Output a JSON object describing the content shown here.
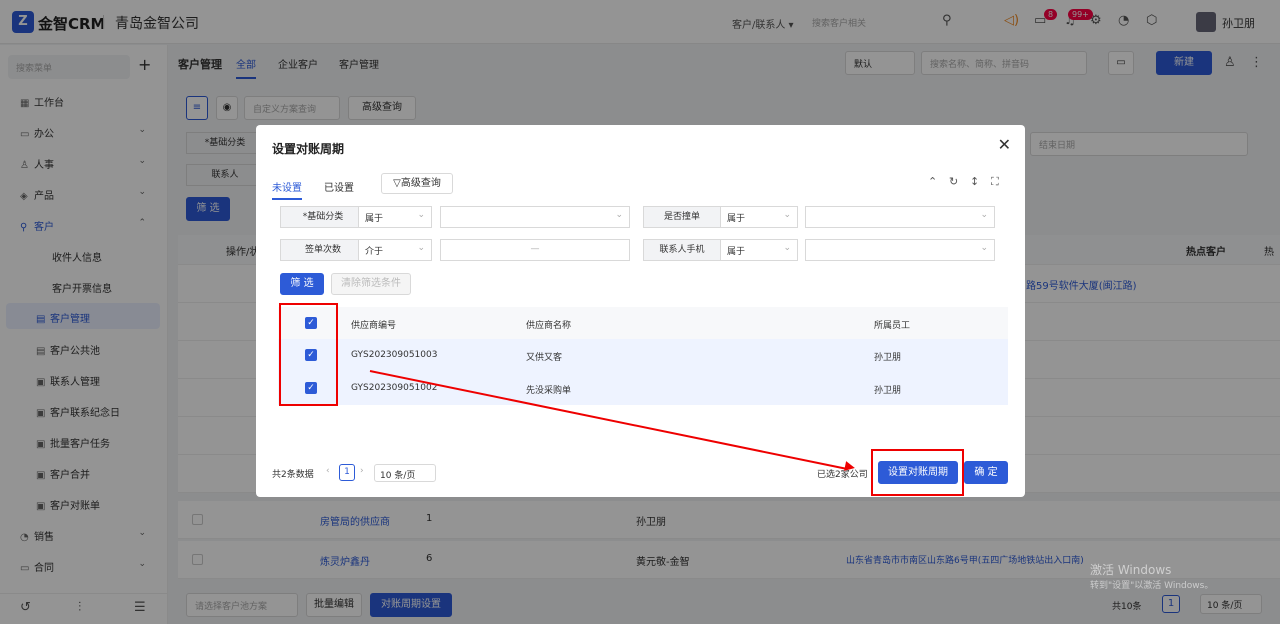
{
  "topbar": {
    "logo_glyph": "Z",
    "brand": "金智CRM",
    "company": "青岛金智公司",
    "search_scope": "客户/联系人 ▾",
    "search_placeholder": "搜索客户相关",
    "badge_msg": "8",
    "badge_notice": "99+",
    "username": "孙卫朋",
    "icons": [
      "search-icon",
      "volume-icon",
      "message-icon",
      "bell-icon",
      "gear-icon",
      "pie-icon",
      "cube-icon"
    ]
  },
  "sidebar": {
    "search_placeholder": "搜索菜单",
    "items": [
      {
        "label": "工作台",
        "icon": "▦"
      },
      {
        "label": "办公",
        "icon": "▭"
      },
      {
        "label": "人事",
        "icon": "♙"
      },
      {
        "label": "产品",
        "icon": "◈"
      },
      {
        "label": "客户",
        "icon": "⚲"
      },
      {
        "label": "收件人信息"
      },
      {
        "label": "客户开票信息"
      },
      {
        "label": "客户管理",
        "icon": "▤"
      },
      {
        "label": "客户公共池",
        "icon": "▤"
      },
      {
        "label": "联系人管理",
        "icon": "▣"
      },
      {
        "label": "客户联系纪念日",
        "icon": "▣"
      },
      {
        "label": "批量客户任务",
        "icon": "▣"
      },
      {
        "label": "客户合并",
        "icon": "▣"
      },
      {
        "label": "客户对账单",
        "icon": "▣"
      },
      {
        "label": "销售",
        "icon": "◔"
      },
      {
        "label": "合同",
        "icon": "▭"
      }
    ]
  },
  "main": {
    "title": "客户管理",
    "tabs": [
      "全部",
      "企业客户",
      "客户管理"
    ],
    "sort_select": "默认",
    "search_placeholder": "搜索名称、简称、拼音码",
    "new_button": "新建",
    "custom_query": "自定义方案查询",
    "advanced_query": "高级查询",
    "filter_label_base": "*基础分类",
    "filter_label_contact": "联系人",
    "filter_button": "筛 选",
    "end_date": "结束日期",
    "col_ops": "操作/状",
    "col_hot": "热点客户",
    "col_hot2": "热",
    "row_addr_partial": "路59号软件大厦(闽江路)",
    "rows": [
      {
        "name": "房管局的供应商",
        "count": "1",
        "owner": "孙卫朋",
        "address": ""
      },
      {
        "name": "炼灵炉鑫丹",
        "count": "6",
        "owner": "黄元敬-金智",
        "address": "山东省青岛市市南区山东路6号甲(五四广场地铁站出入口南)"
      }
    ],
    "bottom_scheme": "请选择客户池方案",
    "bottom_batch": "批量编辑",
    "bottom_period": "对账周期设置",
    "total": "共10条",
    "page": "1",
    "per_page": "10 条/页"
  },
  "dialog": {
    "title": "设置对账周期",
    "tabs": [
      "未设置",
      "已设置"
    ],
    "advanced_query": "高级查询",
    "filters": [
      {
        "label": "*基础分类",
        "op": "属于",
        "value": ""
      },
      {
        "label": "是否撞单",
        "op": "属于",
        "value": ""
      },
      {
        "label": "签单次数",
        "op": "介于",
        "value": "—"
      },
      {
        "label": "联系人手机",
        "op": "属于",
        "value": ""
      }
    ],
    "filter_button": "筛 选",
    "clear_button": "清除筛选条件",
    "columns": [
      "供应商编号",
      "供应商名称",
      "所属员工"
    ],
    "rows": [
      {
        "code": "GYS202309051003",
        "name": "又供又客",
        "owner": "孙卫朋"
      },
      {
        "code": "GYS202309051002",
        "name": "先没采购单",
        "owner": "孙卫朋"
      }
    ],
    "total": "共2条数据",
    "page": "1",
    "per_page": "10 条/页",
    "selected": "已选2家公司",
    "set_period_button": "设置对账周期",
    "confirm_button": "确 定"
  },
  "watermark": {
    "line1": "激活 Windows",
    "line2": "转到\"设置\"以激活 Windows。"
  },
  "colors": {
    "accent": "#2d5bd7",
    "annotation": "#ee0000"
  }
}
